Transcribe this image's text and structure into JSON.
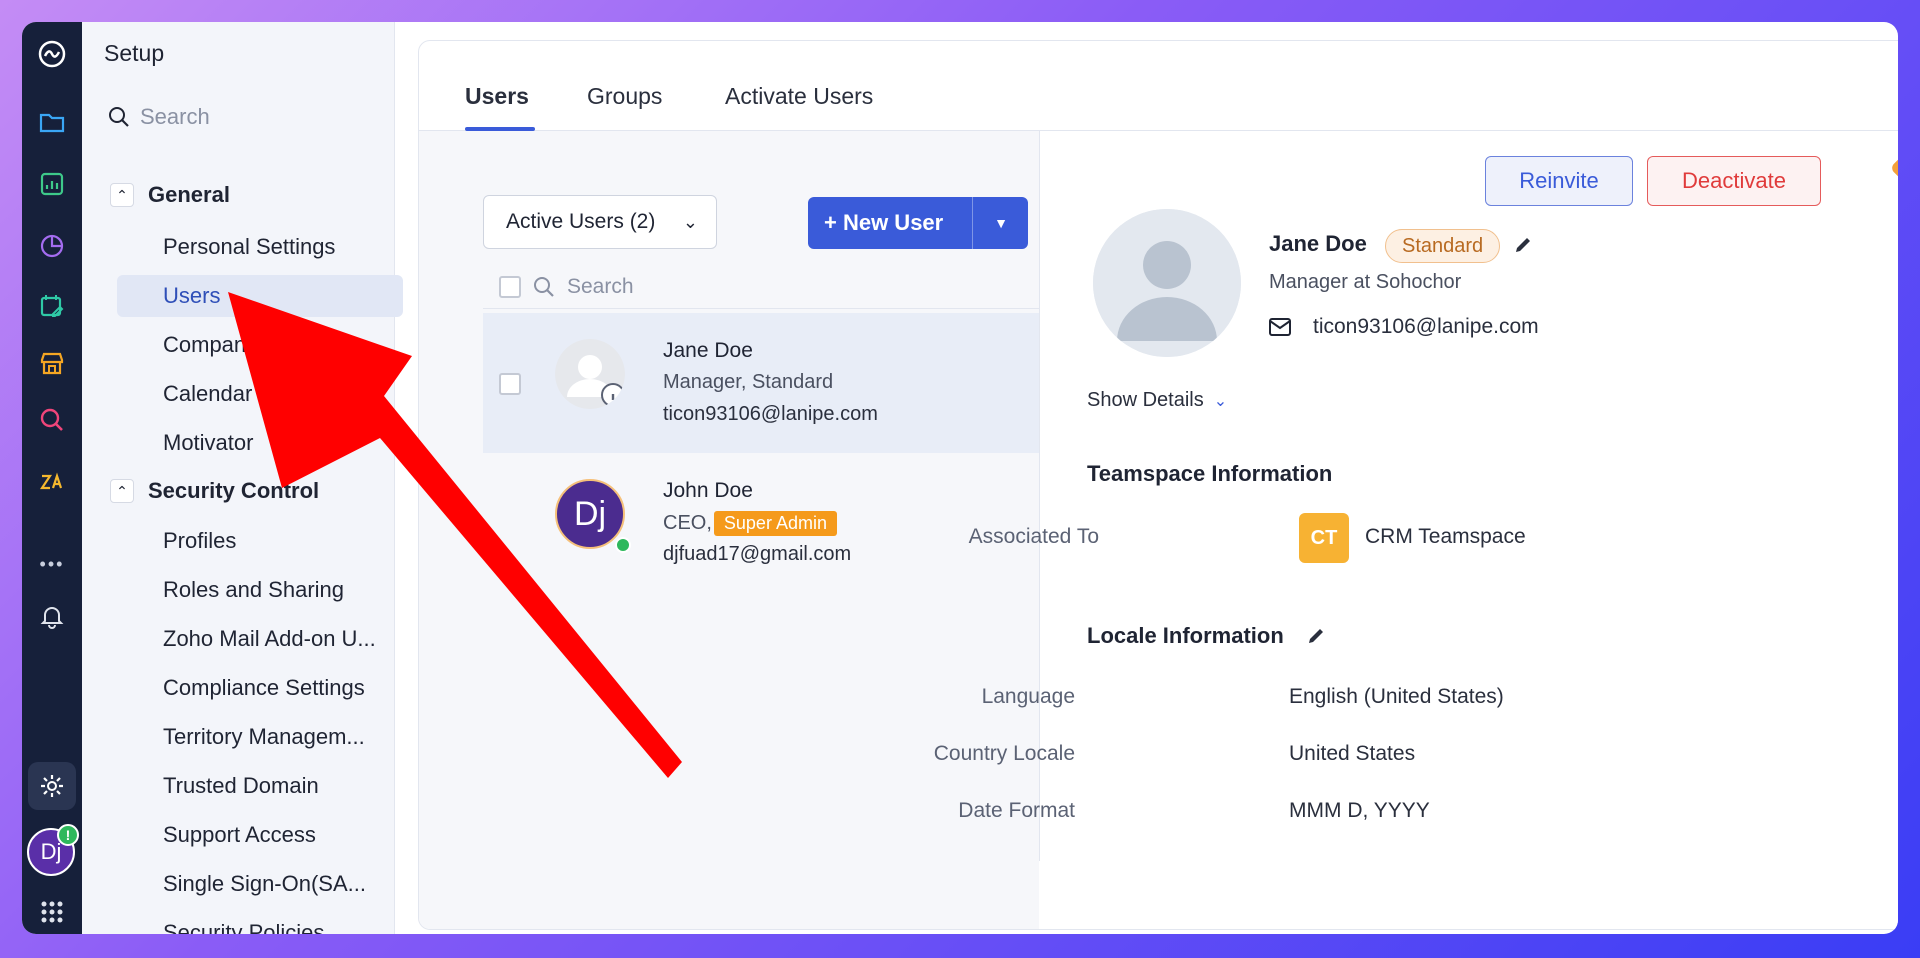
{
  "sidebar": {
    "title": "Setup",
    "search_placeholder": "Search",
    "general_label": "General",
    "security_label": "Security Control",
    "items": [
      "Personal Settings",
      "Users",
      "Company Settings",
      "Calendar",
      "Motivator",
      "Profiles",
      "Roles and Sharing",
      "Zoho Mail Add-on U...",
      "Compliance Settings",
      "Territory Managem...",
      "Trusted Domain",
      "Support Access",
      "Single Sign-On(SA...",
      "Security Policies"
    ]
  },
  "rail": {
    "more": "•••",
    "avatar": "Dj",
    "badge": "!"
  },
  "tabs": [
    "Users",
    "Groups",
    "Activate Users"
  ],
  "list": {
    "filter": "Active Users (2)",
    "new_user": "+ New User",
    "search_placeholder": "Search",
    "users": [
      {
        "name": "Jane Doe",
        "meta": "Manager, Standard",
        "email": "ticon93106@lanipe.com"
      },
      {
        "name": "John Doe",
        "meta_prefix": "CEO,",
        "badge": "Super Admin",
        "email": "djfuad17@gmail.com",
        "initials": "Dj"
      }
    ]
  },
  "detail": {
    "reinvite": "Reinvite",
    "deactivate": "Deactivate",
    "name": "Jane Doe",
    "badge": "Standard",
    "role": "Manager at Sohochor",
    "email": "ticon93106@lanipe.com",
    "show_details": "Show Details",
    "teamspace_title": "Teamspace Information",
    "associated_label": "Associated To",
    "ct_initials": "CT",
    "teamspace_name": "CRM Teamspace",
    "locale_title": "Locale Information",
    "language_label": "Language",
    "language_value": "English (United States)",
    "country_label": "Country Locale",
    "country_value": "United States",
    "date_label": "Date Format",
    "date_value": "MMM D, YYYY"
  },
  "colors": {
    "accent": "#3a5bd9",
    "arrow": "#ff0000",
    "super_admin": "#f59a1b",
    "danger": "#e03b3b"
  }
}
